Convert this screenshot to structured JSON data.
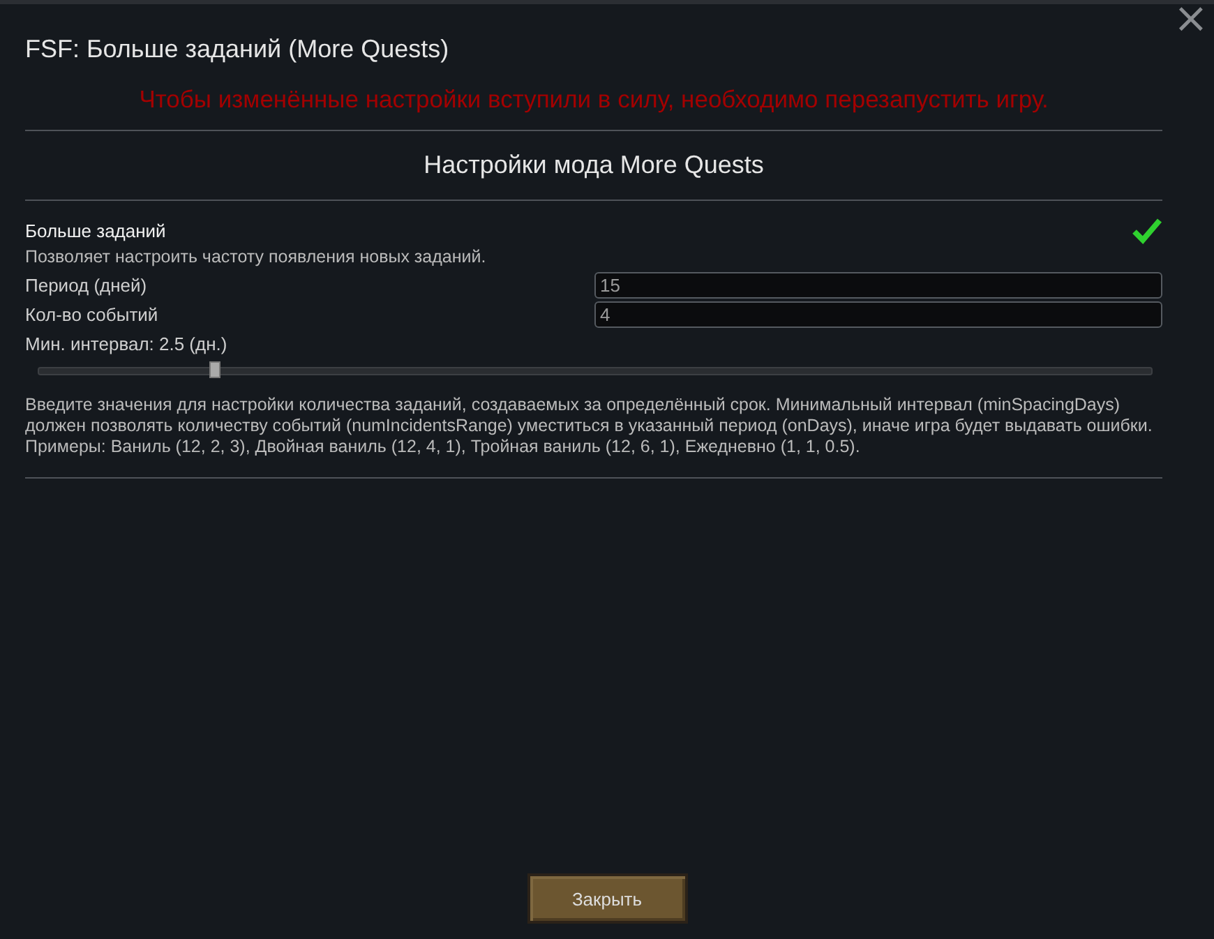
{
  "window": {
    "title": "FSF: Больше заданий (More Quests)",
    "close": "×"
  },
  "warning": "Чтобы изменённые настройки вступили в силу, необходимо перезапустить игру.",
  "section_title": "Настройки мода More Quests",
  "toggle": {
    "label": "Больше заданий",
    "checked": true
  },
  "description": "Позволяет настроить частоту появления новых заданий.",
  "fields": [
    {
      "label": "Период (дней)",
      "value": "15"
    },
    {
      "label": "Кол-во событий",
      "value": "4"
    }
  ],
  "slider": {
    "label": "Мин. интервал: 2.5 (дн.)",
    "level": 0.158
  },
  "help": [
    "Введите значения для настройки количества заданий, создаваемых за определённый срок. Минимальный интервал (minSpacingDays) должен позволять количеству событий (numIncidentsRange) уместиться в указанный период (onDays), иначе игра будет выдавать ошибки.",
    "Примеры: Ваниль (12, 2, 3), Двойная ваниль (12, 4, 1), Тройная ваниль (12, 6, 1), Ежедневно (1, 1, 0.5)."
  ],
  "buttons": [
    "Закрыть"
  ]
}
